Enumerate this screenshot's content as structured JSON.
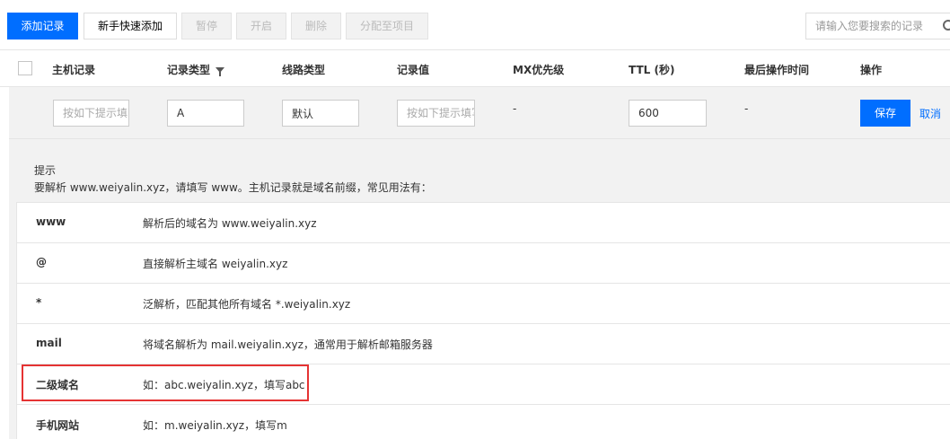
{
  "toolbar": {
    "add_record": "添加记录",
    "quick_add": "新手快速添加",
    "pause": "暂停",
    "enable": "开启",
    "delete": "删除",
    "assign_project": "分配至项目",
    "search_placeholder": "请输入您要搜索的记录"
  },
  "table": {
    "columns": [
      "主机记录",
      "记录类型",
      "线路类型",
      "记录值",
      "MX优先级",
      "TTL (秒)",
      "最后操作时间",
      "操作"
    ]
  },
  "edit_row": {
    "host_placeholder": "按如下提示填写",
    "record_type": "A",
    "line_type": "默认",
    "value_placeholder": "按如下提示填写",
    "mx": "-",
    "ttl": "600",
    "last_time": "-",
    "save": "保存",
    "cancel": "取消"
  },
  "tips": {
    "title": "提示",
    "description": "要解析 www.weiyalin.xyz，请填写 www。主机记录就是域名前缀，常见用法有：",
    "rows": [
      {
        "key": "www",
        "value": "解析后的域名为 www.weiyalin.xyz"
      },
      {
        "key": "@",
        "value": "直接解析主域名 weiyalin.xyz"
      },
      {
        "key": "*",
        "value": "泛解析，匹配其他所有域名 *.weiyalin.xyz"
      },
      {
        "key": "mail",
        "value": "将域名解析为 mail.weiyalin.xyz，通常用于解析邮箱服务器"
      },
      {
        "key": "二级域名",
        "value": "如：abc.weiyalin.xyz，填写abc"
      },
      {
        "key": "手机网站",
        "value": "如：m.weiyalin.xyz，填写m"
      }
    ]
  },
  "colors": {
    "primary": "#006eff",
    "highlight_border": "#e53333"
  }
}
